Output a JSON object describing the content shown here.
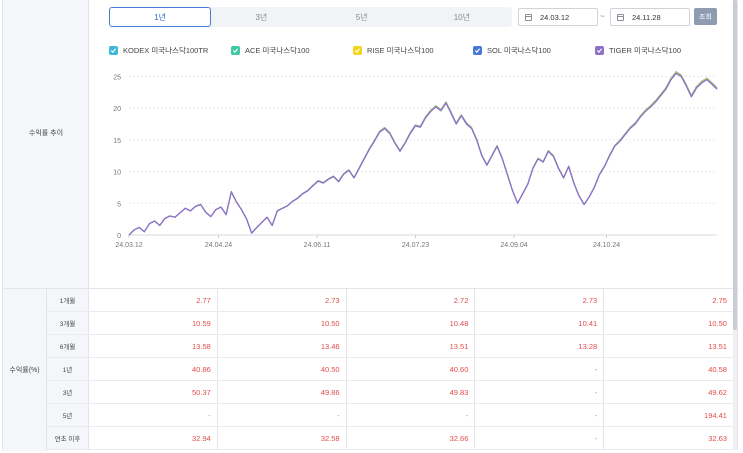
{
  "period_tabs": [
    "1년",
    "3년",
    "5년",
    "10년"
  ],
  "active_period_index": 0,
  "date_range": {
    "start": "24.03.12",
    "end": "24.11.28",
    "separator": "~"
  },
  "query_button": "조회",
  "section_labels": {
    "trend": "수익률 추이",
    "returns": "수익률(%)"
  },
  "legend": [
    {
      "name": "KODEX 미국나스닥100TR",
      "color": "#3fb8d9",
      "checked": true
    },
    {
      "name": "ACE 미국나스닥100",
      "color": "#3cc9a4",
      "checked": true
    },
    {
      "name": "RISE 미국나스닥100",
      "color": "#f2d51c",
      "checked": true
    },
    {
      "name": "SOL 미국나스닥100",
      "color": "#4a78d6",
      "checked": true
    },
    {
      "name": "TIGER 미국나스닥100",
      "color": "#8e6fc9",
      "checked": true
    }
  ],
  "chart_data": {
    "type": "line",
    "ylim": [
      0,
      26
    ],
    "yticks": [
      "0",
      "5",
      "10",
      "15",
      "20",
      "25"
    ],
    "xticks": [
      "24.03.12",
      "24.04.24",
      "24.06.11",
      "24.07.23",
      "24.09.04",
      "24.10.24"
    ],
    "xtick_positions": [
      0,
      30,
      63,
      96,
      129,
      160
    ],
    "num_points": 197,
    "series_values": [
      0,
      0.8,
      1.2,
      0.5,
      1.8,
      2.2,
      1.5,
      2.6,
      3.0,
      2.8,
      3.5,
      4.2,
      3.8,
      4.5,
      4.8,
      3.6,
      2.9,
      4.0,
      4.4,
      3.2,
      6.8,
      5.2,
      4.0,
      2.5,
      0.3,
      1.2,
      2.0,
      2.8,
      1.5,
      3.8,
      4.2,
      4.6,
      5.3,
      5.8,
      6.5,
      7.0,
      7.8,
      8.5,
      8.2,
      8.8,
      9.2,
      8.4,
      9.6,
      10.2,
      9.0,
      10.5,
      12.0,
      13.5,
      14.8,
      16.2,
      16.8,
      16.0,
      14.5,
      13.2,
      14.5,
      16.0,
      17.2,
      17.0,
      18.5,
      19.5,
      20.2,
      19.6,
      20.8,
      19.2,
      17.5,
      18.8,
      17.5,
      16.8,
      15.0,
      12.5,
      11.0,
      12.5,
      14.0,
      12.0,
      9.5,
      7.0,
      5.0,
      6.5,
      8.0,
      10.5,
      12.0,
      11.5,
      13.2,
      12.4,
      10.5,
      9.0,
      10.8,
      8.2,
      6.2,
      4.8,
      6.0,
      7.5,
      9.5,
      10.8,
      12.5,
      14.0,
      14.8,
      15.8,
      16.8,
      17.5,
      18.6,
      19.5,
      20.2,
      21.0,
      22.0,
      23.0,
      24.5,
      25.5,
      25.0,
      23.5,
      21.8,
      23.2,
      24.0,
      24.5,
      23.8,
      23.0
    ],
    "series_offsets": [
      0.25,
      0.1,
      0.15,
      -0.05,
      0
    ]
  },
  "returns_table": {
    "rows": [
      {
        "label": "1개월",
        "values": [
          "2.77",
          "2.73",
          "2.72",
          "2.73",
          "2.75"
        ]
      },
      {
        "label": "3개월",
        "values": [
          "10.59",
          "10.50",
          "10.48",
          "10.41",
          "10.50"
        ]
      },
      {
        "label": "6개월",
        "values": [
          "13.58",
          "13.46",
          "13.51",
          "13.28",
          "13.51"
        ]
      },
      {
        "label": "1년",
        "values": [
          "40.86",
          "40.50",
          "40.60",
          "-",
          "40.58"
        ]
      },
      {
        "label": "3년",
        "values": [
          "50.37",
          "49.86",
          "49.83",
          "-",
          "49.62"
        ]
      },
      {
        "label": "5년",
        "values": [
          "-",
          "-",
          "-",
          "-",
          "194.41"
        ]
      },
      {
        "label": "연초 이후",
        "values": [
          "32.94",
          "32.58",
          "32.66",
          "-",
          "32.63"
        ]
      }
    ]
  }
}
